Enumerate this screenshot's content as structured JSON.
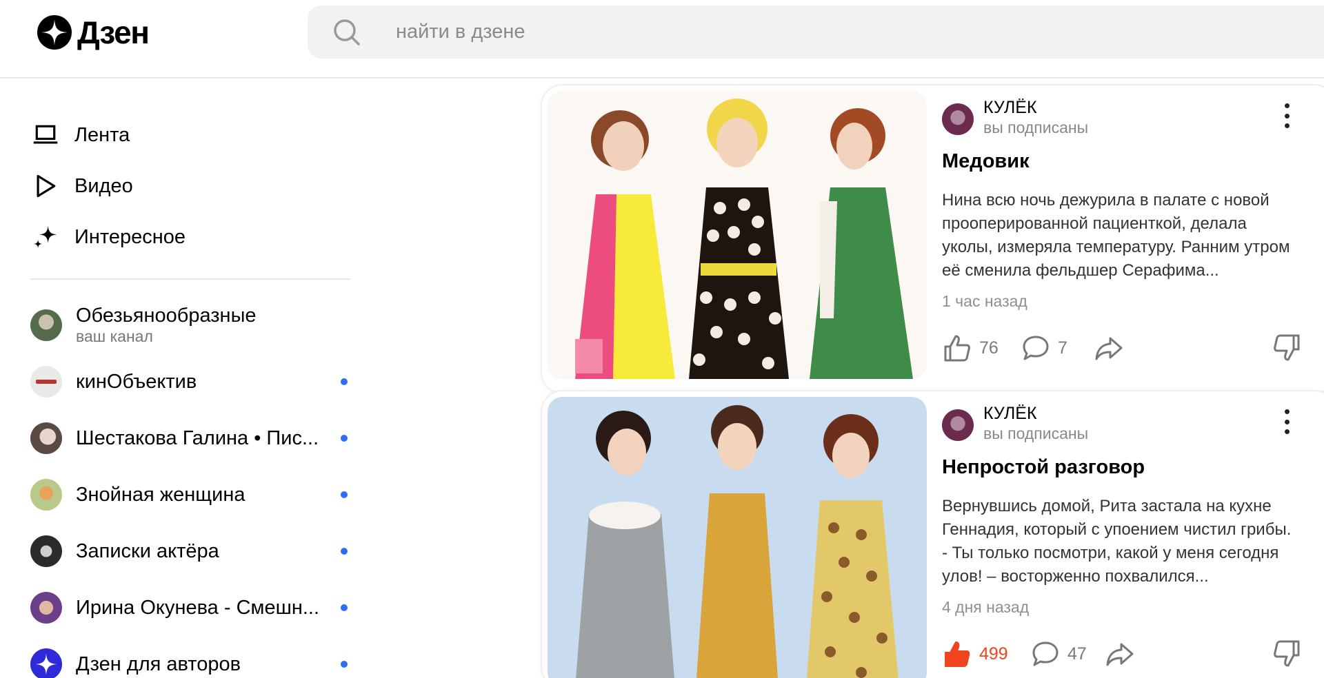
{
  "header": {
    "logo_text": "Дзен",
    "search_placeholder": "найти в дзене"
  },
  "sidebar": {
    "nav": [
      {
        "label": "Лента",
        "icon": "laptop-icon"
      },
      {
        "label": "Видео",
        "icon": "play-icon"
      },
      {
        "label": "Интересное",
        "icon": "sparkle-icon"
      }
    ],
    "channels": [
      {
        "name": "Обезьянообразные",
        "subtitle": "ваш канал",
        "has_new": false,
        "avatar_color": "#556b4a"
      },
      {
        "name": "кинОбъектив",
        "subtitle": "",
        "has_new": true,
        "avatar_color": "#e9e6e6"
      },
      {
        "name": "Шестакова Галина • Пис...",
        "subtitle": "",
        "has_new": true,
        "avatar_color": "#5a4a44"
      },
      {
        "name": "Знойная женщина",
        "subtitle": "",
        "has_new": true,
        "avatar_color": "#b9c98a"
      },
      {
        "name": "Записки актёра",
        "subtitle": "",
        "has_new": true,
        "avatar_color": "#2b2b2b"
      },
      {
        "name": "Ирина Окунева - Смешн...",
        "subtitle": "",
        "has_new": true,
        "avatar_color": "#6b3f8a"
      },
      {
        "name": "Дзен для авторов",
        "subtitle": "",
        "has_new": true,
        "avatar_color": "#2f2ad9"
      }
    ],
    "dot_color": "#2e6ef5"
  },
  "feed": [
    {
      "channel": "КУЛЁК",
      "channel_status": "вы подписаны",
      "title": "Медовик",
      "text": "Нина всю ночь дежурила в палате с новой прооперированной пациенткой, делала уколы, измеряла температуру. Ранним утром её сменила фельдшер Серафима...",
      "time": "1 час назад",
      "likes": "76",
      "comments": "7",
      "liked": false,
      "image_desc": "vintage-dresses-illustration-1"
    },
    {
      "channel": "КУЛЁК",
      "channel_status": "вы подписаны",
      "title": "Непростой разговор",
      "text": "Вернувшись домой, Рита застала на кухне Геннадия, который с упоением чистил грибы. - Ты только посмотри, какой у меня сегодня улов! – восторженно похвалился...",
      "time": "4 дня назад",
      "likes": "499",
      "comments": "47",
      "liked": true,
      "image_desc": "vintage-dresses-illustration-2"
    }
  ],
  "colors": {
    "accent_like": "#f0441f",
    "text_muted": "#8f8f8f"
  }
}
